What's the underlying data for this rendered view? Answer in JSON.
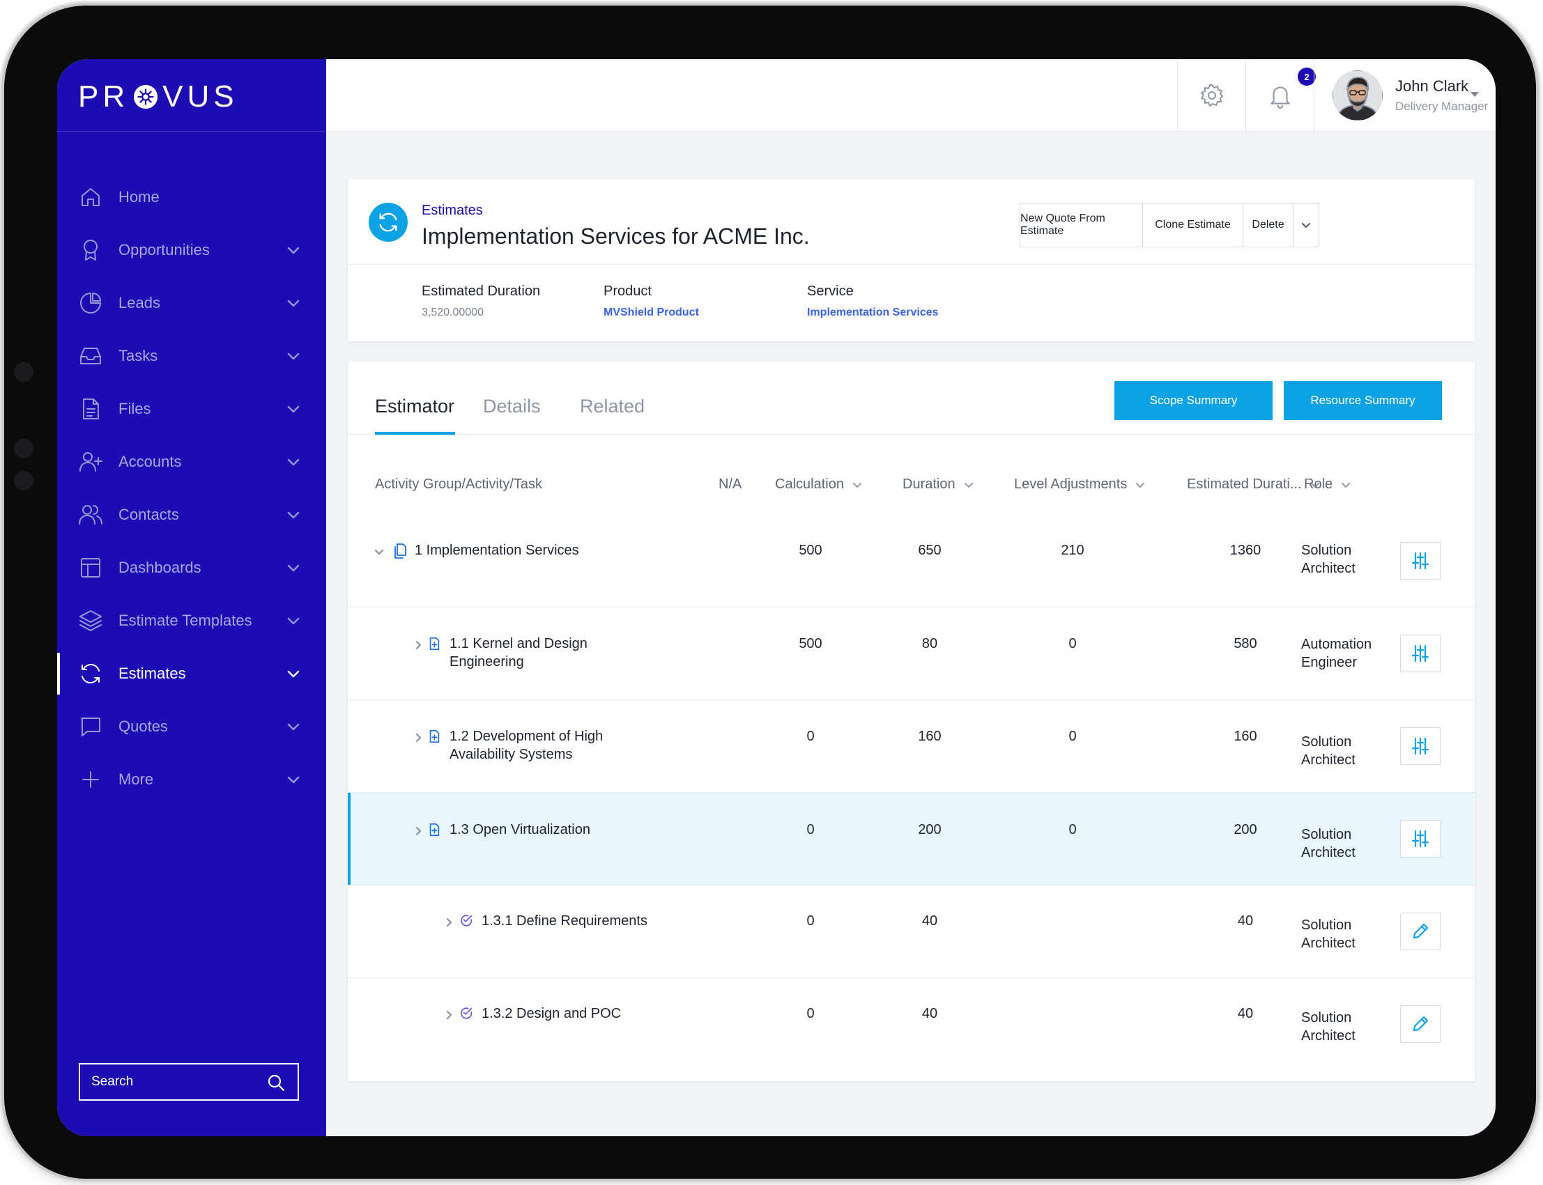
{
  "sidebar": {
    "brand": "PR",
    "brand_tail": "VUS",
    "items": [
      {
        "label": "Home"
      },
      {
        "label": "Opportunities"
      },
      {
        "label": "Leads"
      },
      {
        "label": "Tasks"
      },
      {
        "label": "Files"
      },
      {
        "label": "Accounts"
      },
      {
        "label": "Contacts"
      },
      {
        "label": "Dashboards"
      },
      {
        "label": "Estimate Templates"
      },
      {
        "label": "Estimates"
      },
      {
        "label": "Quotes"
      },
      {
        "label": "More"
      }
    ],
    "search_placeholder": "Search"
  },
  "topbar": {
    "notification_count": "2",
    "user_name": "John Clark",
    "user_role": "Delivery Manager"
  },
  "header": {
    "breadcrumb": "Estimates",
    "title": "Implementation Services for ACME Inc.",
    "buttons": {
      "new_quote": "New Quote From Estimate",
      "clone": "Clone Estimate",
      "delete": "Delete"
    },
    "fields": [
      {
        "label": "Estimated Duration",
        "value": "3,520.00000"
      },
      {
        "label": "Product",
        "value": "MVShield Product"
      },
      {
        "label": "Service",
        "value": "Implementation Services"
      }
    ]
  },
  "estimator": {
    "tabs": [
      "Estimator",
      "Details",
      "Related"
    ],
    "buttons": {
      "scope": "Scope Summary",
      "resource": "Resource Summary"
    },
    "columns": [
      "Activity Group/Activity/Task",
      "N/A",
      "Calculation",
      "Duration",
      "Level Adjustments",
      "Estimated Durati...",
      "Role"
    ],
    "rows": [
      {
        "name": "1 Implementation Services",
        "calc": "500",
        "duration": "650",
        "level": "210",
        "est": "1360",
        "role1": "Solution",
        "role2": "Architect"
      },
      {
        "name": "1.1 Kernel and Design",
        "name2": "Engineering",
        "calc": "500",
        "duration": "80",
        "level": "0",
        "est": "580",
        "role1": "Automation",
        "role2": "Engineer"
      },
      {
        "name": "1.2 Development of High",
        "name2": "Availability Systems",
        "calc": "0",
        "duration": "160",
        "level": "0",
        "est": "160",
        "role1": "Solution",
        "role2": "Architect"
      },
      {
        "name": "1.3 Open Virtualization",
        "calc": "0",
        "duration": "200",
        "level": "0",
        "est": "200",
        "role1": "Solution",
        "role2": "Architect"
      },
      {
        "name": "1.3.1 Define Requirements",
        "calc": "0",
        "duration": "40",
        "level": "",
        "est": "40",
        "role1": "Solution",
        "role2": "Architect"
      },
      {
        "name": "1.3.2 Design and POC",
        "calc": "0",
        "duration": "40",
        "level": "",
        "est": "40",
        "role1": "Solution",
        "role2": "Architect"
      }
    ]
  },
  "colors": {
    "sidebar": "#1d0bb4",
    "accent": "#0da1e6",
    "link": "#3b64e8"
  }
}
